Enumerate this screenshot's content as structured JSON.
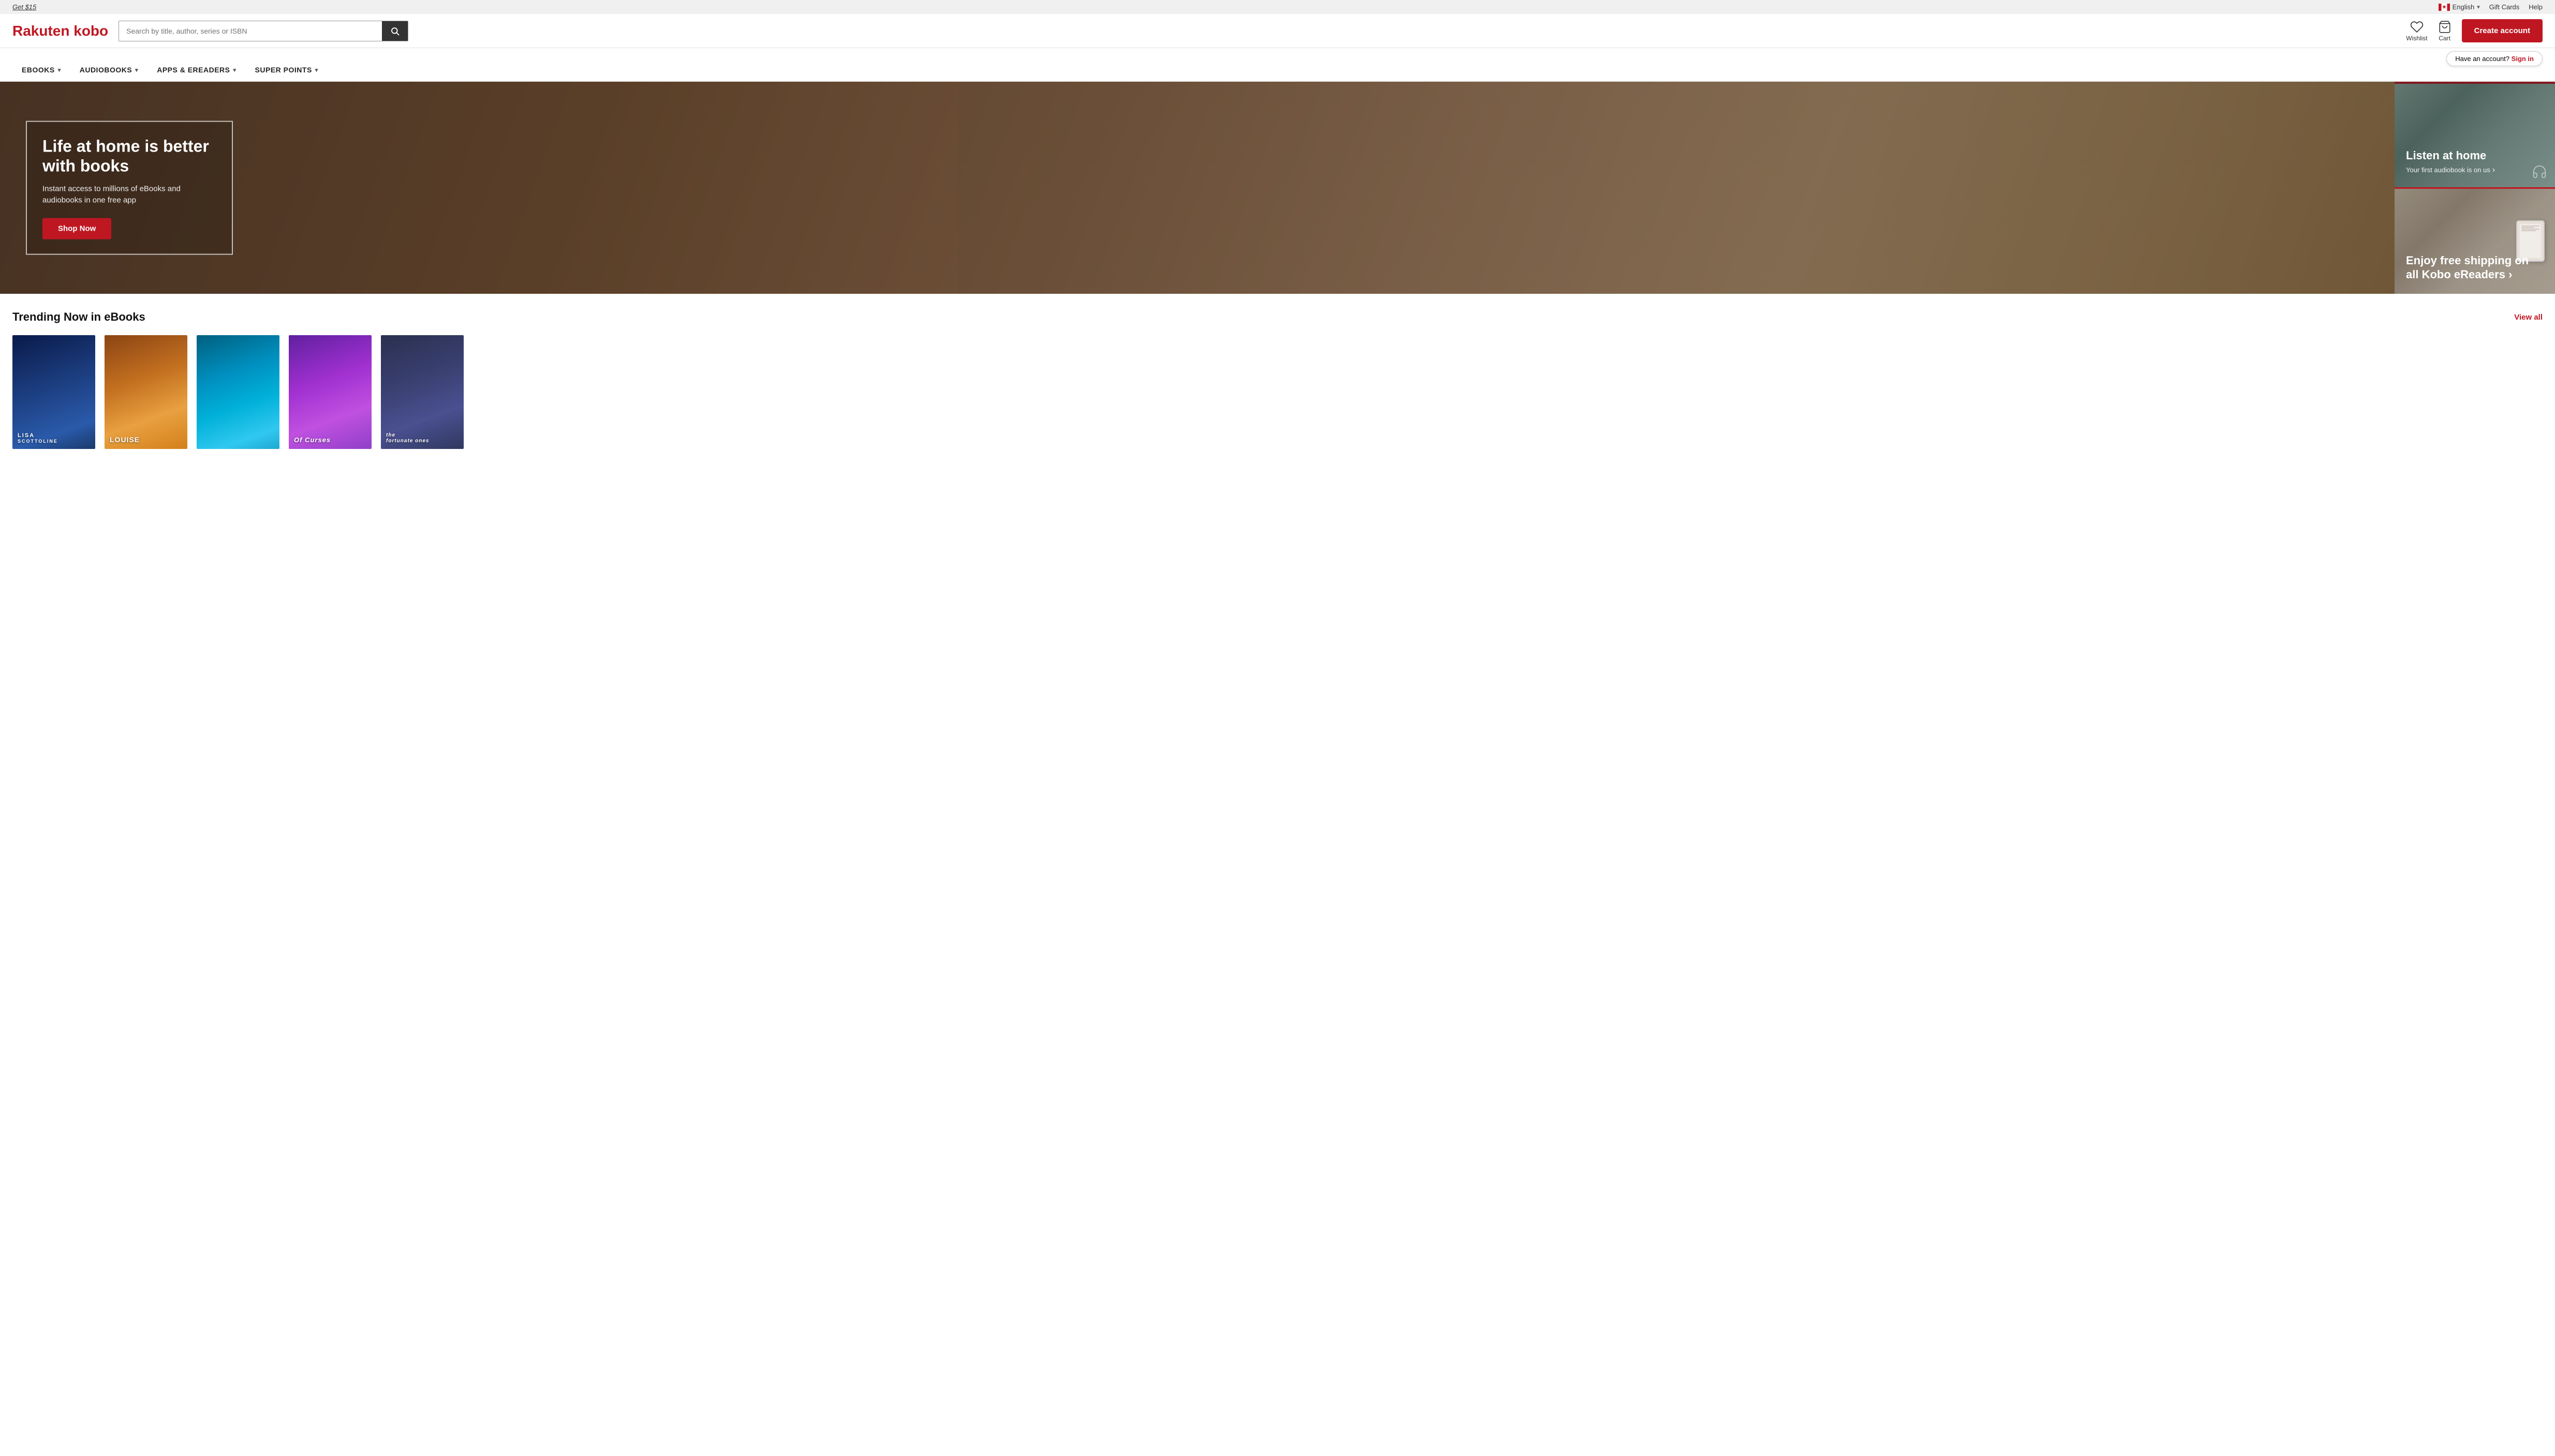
{
  "topbar": {
    "promo_link": "Get $15",
    "language": "English",
    "gift_cards": "Gift Cards",
    "help": "Help"
  },
  "header": {
    "logo": "Rakuten kobo",
    "search_placeholder": "Search by title, author, series or ISBN",
    "wishlist_label": "Wishlist",
    "cart_label": "Cart",
    "create_account_label": "Create account",
    "have_account_text": "Have an account?",
    "sign_in_label": "Sign in"
  },
  "nav": {
    "items": [
      {
        "label": "eBOOKS",
        "has_dropdown": true
      },
      {
        "label": "AUDIOBOOKS",
        "has_dropdown": true
      },
      {
        "label": "APPS & eREADERS",
        "has_dropdown": true
      },
      {
        "label": "SUPER POINTS",
        "has_dropdown": true
      }
    ]
  },
  "hero": {
    "main": {
      "title": "Life at home is better with books",
      "subtitle": "Instant access to millions of eBooks and audiobooks in one free app",
      "cta_label": "Shop Now"
    },
    "side_top": {
      "title": "Listen at home",
      "subtitle": "Your first audiobook is on us"
    },
    "side_bottom": {
      "title": "Enjoy free shipping on all Kobo eReaders"
    }
  },
  "trending": {
    "section_title": "Trending Now in eBooks",
    "view_all_label": "View all",
    "books": [
      {
        "author": "Lisa Scottoline",
        "color_class": "book-1"
      },
      {
        "author": "Louise",
        "color_class": "book-2"
      },
      {
        "author": "",
        "color_class": "book-3"
      },
      {
        "author": "Of Curses",
        "color_class": "book-4"
      },
      {
        "author": "The Fortunate Ones",
        "color_class": "book-5"
      }
    ]
  }
}
